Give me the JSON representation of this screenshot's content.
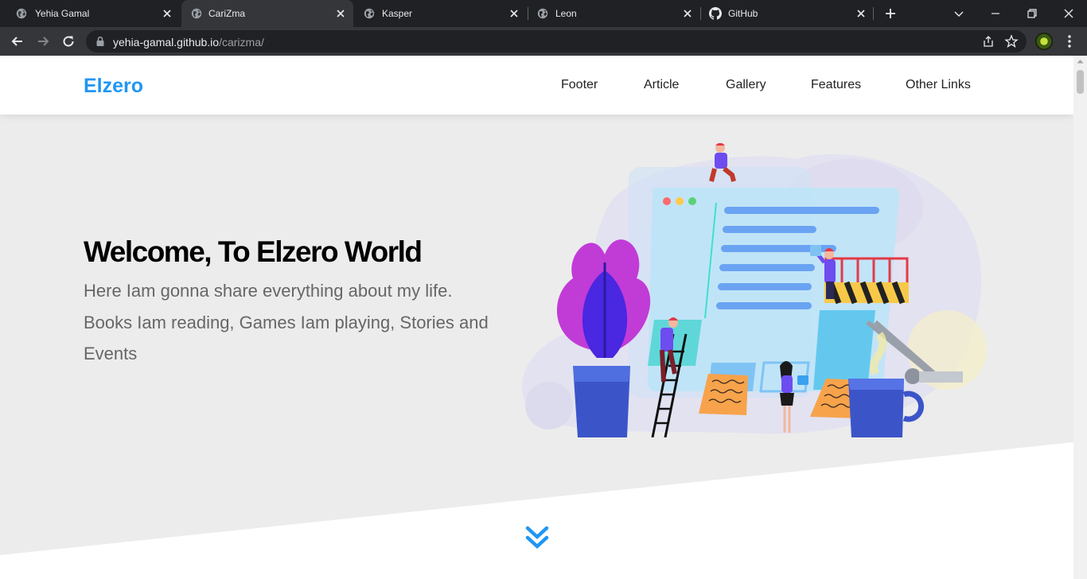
{
  "browser": {
    "tabs": [
      {
        "title": "Yehia Gamal",
        "icon": "globe-icon",
        "active": false
      },
      {
        "title": "CariZma",
        "icon": "globe-icon",
        "active": true
      },
      {
        "title": "Kasper",
        "icon": "globe-icon",
        "active": false
      },
      {
        "title": "Leon",
        "icon": "globe-icon",
        "active": false
      },
      {
        "title": "GitHub",
        "icon": "github-icon",
        "active": false
      }
    ],
    "url_host": "yehia-gamal.github.io",
    "url_path": "/carizma/"
  },
  "site": {
    "logo": "Elzero",
    "nav": [
      "Footer",
      "Article",
      "Gallery",
      "Features",
      "Other Links"
    ],
    "hero": {
      "title": "Welcome, To Elzero World",
      "text": "Here Iam gonna share everything about my life. Books Iam reading, Games Iam playing, Stories and Events"
    }
  },
  "colors": {
    "accent": "#2196f3",
    "tab_bar": "#202124",
    "toolbar": "#35363a",
    "hero_bg": "#ececec"
  }
}
